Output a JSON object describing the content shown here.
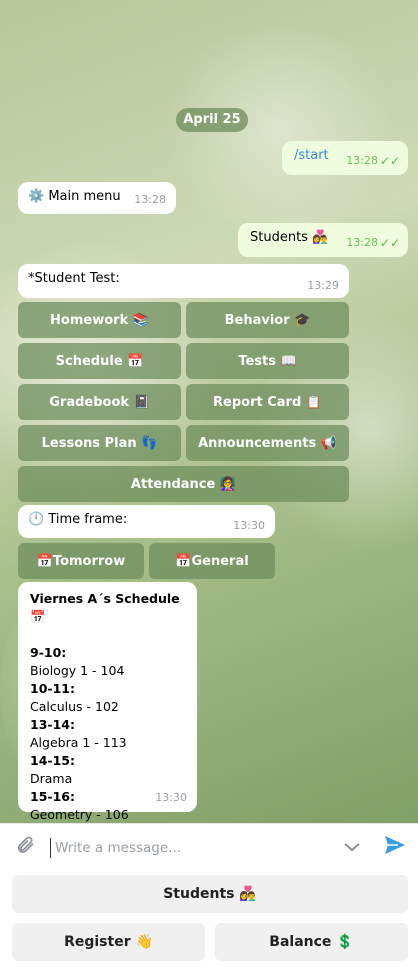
{
  "chat": {
    "date": "April 25",
    "messages": {
      "start": {
        "text": "/start",
        "time": "13:28",
        "ticks": "✓✓"
      },
      "main_menu": {
        "icon": "⚙️",
        "text": "Main menu",
        "time": "13:28"
      },
      "students": {
        "text": "Students 👩‍❤️‍👨",
        "time": "13:28",
        "ticks": "✓✓"
      },
      "student_test": {
        "text": "*Student Test:",
        "time": "13:29"
      },
      "time_frame": {
        "icon": "🕛",
        "text": "Time frame:",
        "time": "13:30"
      },
      "schedule": {
        "title": "Viernes A´s Schedule 📅",
        "time": "13:30",
        "entries": [
          {
            "slot": "9-10:",
            "subject": "Biology 1 - 104"
          },
          {
            "slot": "10-11:",
            "subject": "Calculus - 102"
          },
          {
            "slot": "13-14:",
            "subject": "Algebra 1 - 113"
          },
          {
            "slot": "14-15:",
            "subject": "Drama"
          },
          {
            "slot": "15-16:",
            "subject": "Geometry - 106"
          }
        ]
      }
    },
    "inline_keyboard_main": [
      {
        "label": "Homework 📚"
      },
      {
        "label": "Behavior 🎓"
      },
      {
        "label": "Schedule 📅"
      },
      {
        "label": "Tests 📖"
      },
      {
        "label": "Gradebook 📓"
      },
      {
        "label": "Report Card 📋"
      },
      {
        "label": "Lessons Plan 👣"
      },
      {
        "label": "Announcements 📢"
      },
      {
        "label": "Attendance 👩‍🏫"
      }
    ],
    "inline_keyboard_time": [
      {
        "label": "📅Tomorrow"
      },
      {
        "label": "📅General"
      }
    ]
  },
  "composer": {
    "placeholder": "Write a message...",
    "attach_icon": "paperclip-icon",
    "send_icon": "send-icon"
  },
  "reply_keyboard": {
    "students": "Students 👩‍❤️‍👨",
    "register": "Register 👋",
    "balance": "Balance 💲"
  }
}
